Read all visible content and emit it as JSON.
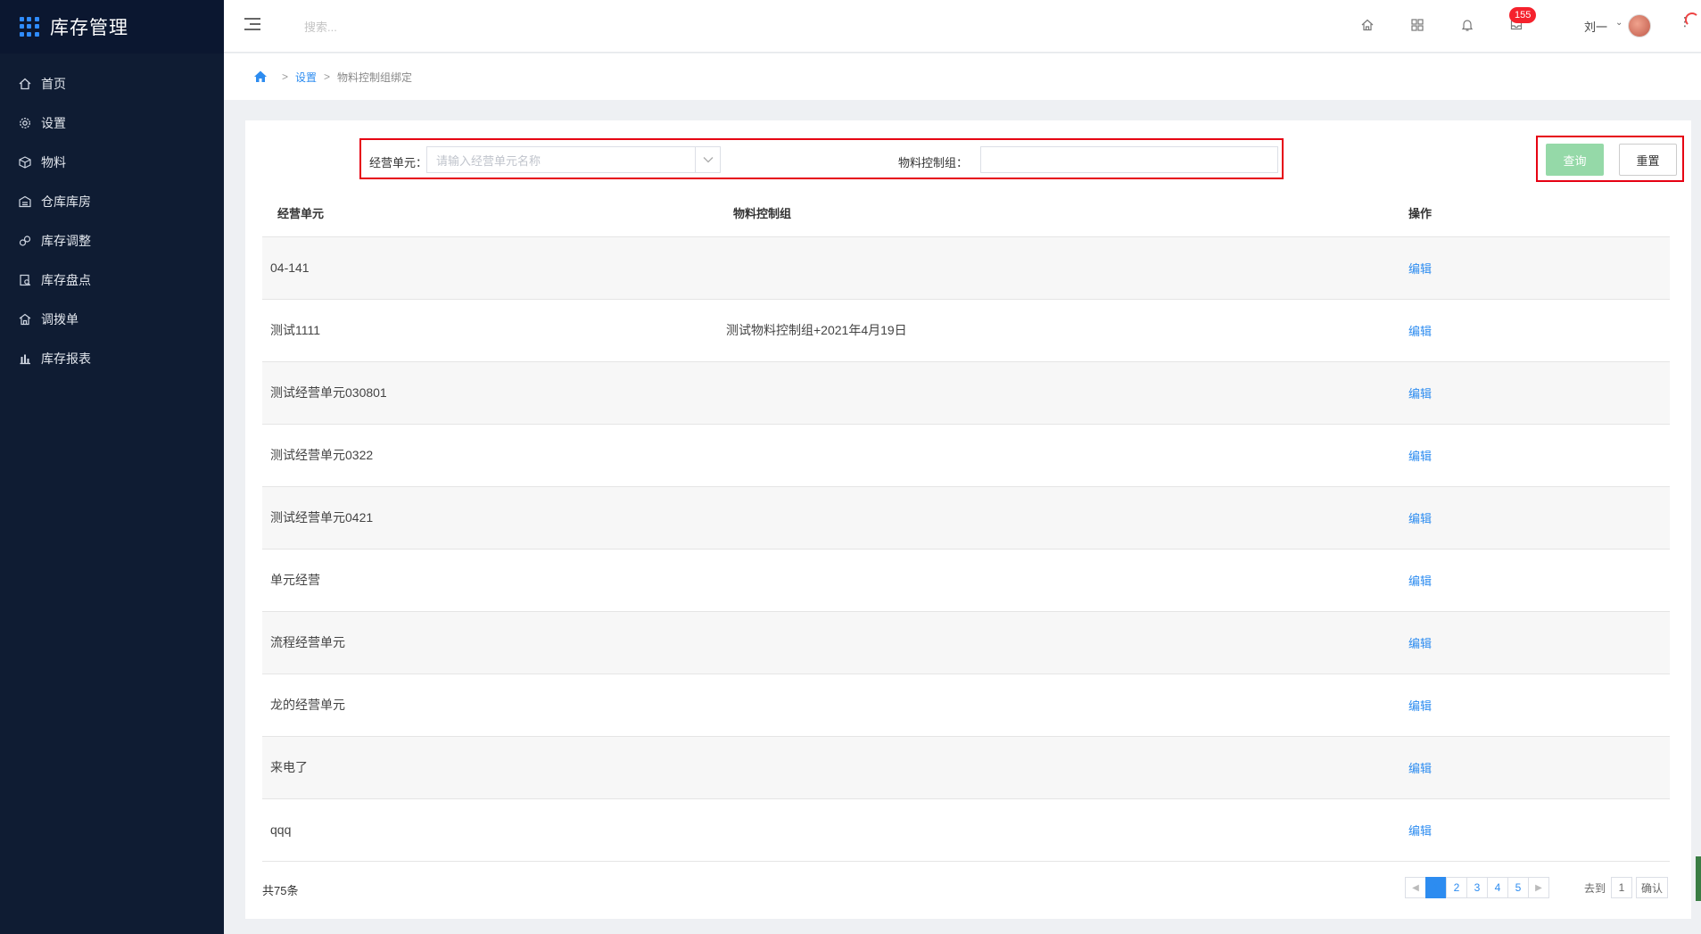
{
  "app": {
    "title": "库存管理"
  },
  "sidebar": {
    "items": [
      {
        "label": "首页",
        "icon": "home-icon"
      },
      {
        "label": "设置",
        "icon": "gear-icon"
      },
      {
        "label": "物料",
        "icon": "cube-icon"
      },
      {
        "label": "仓库库房",
        "icon": "warehouse-icon"
      },
      {
        "label": "库存调整",
        "icon": "adjust-icon"
      },
      {
        "label": "库存盘点",
        "icon": "inventory-icon"
      },
      {
        "label": "调拨单",
        "icon": "transfer-icon"
      },
      {
        "label": "库存报表",
        "icon": "bar-chart-icon"
      }
    ]
  },
  "header": {
    "search_placeholder": "搜索...",
    "badge_count": "155",
    "user_name": "刘一"
  },
  "breadcrumb": {
    "level1": "设置",
    "current": "物料控制组绑定"
  },
  "filters": {
    "unit_label": "经营单元：",
    "unit_placeholder": "请输入经营单元名称",
    "group_label": "物料控制组：",
    "group_value": "",
    "query_label": "查询",
    "reset_label": "重置"
  },
  "table": {
    "columns": [
      "经营单元",
      "物料控制组",
      "操作"
    ],
    "action_label": "编辑",
    "rows": [
      {
        "unit": "04-141",
        "group": ""
      },
      {
        "unit": "测试1111",
        "group": "测试物料控制组+2021年4月19日"
      },
      {
        "unit": "测试经营单元030801",
        "group": ""
      },
      {
        "unit": "测试经营单元0322",
        "group": ""
      },
      {
        "unit": "测试经营单元0421",
        "group": ""
      },
      {
        "unit": "单元经营",
        "group": ""
      },
      {
        "unit": "流程经营单元",
        "group": ""
      },
      {
        "unit": "龙的经营单元",
        "group": ""
      },
      {
        "unit": "来电了",
        "group": ""
      },
      {
        "unit": "qqq",
        "group": ""
      }
    ]
  },
  "pagination": {
    "total_text": "共75条",
    "pages": [
      "1",
      "2",
      "3",
      "4",
      "5"
    ],
    "current_page": "1",
    "goto_label": "去到",
    "goto_value": "1",
    "confirm_label": "确认"
  },
  "colors": {
    "sidebar_bg": "#0f1c33",
    "accent": "#2d8cf0",
    "query_btn": "#95d9a8",
    "highlight_border": "#e60012"
  }
}
